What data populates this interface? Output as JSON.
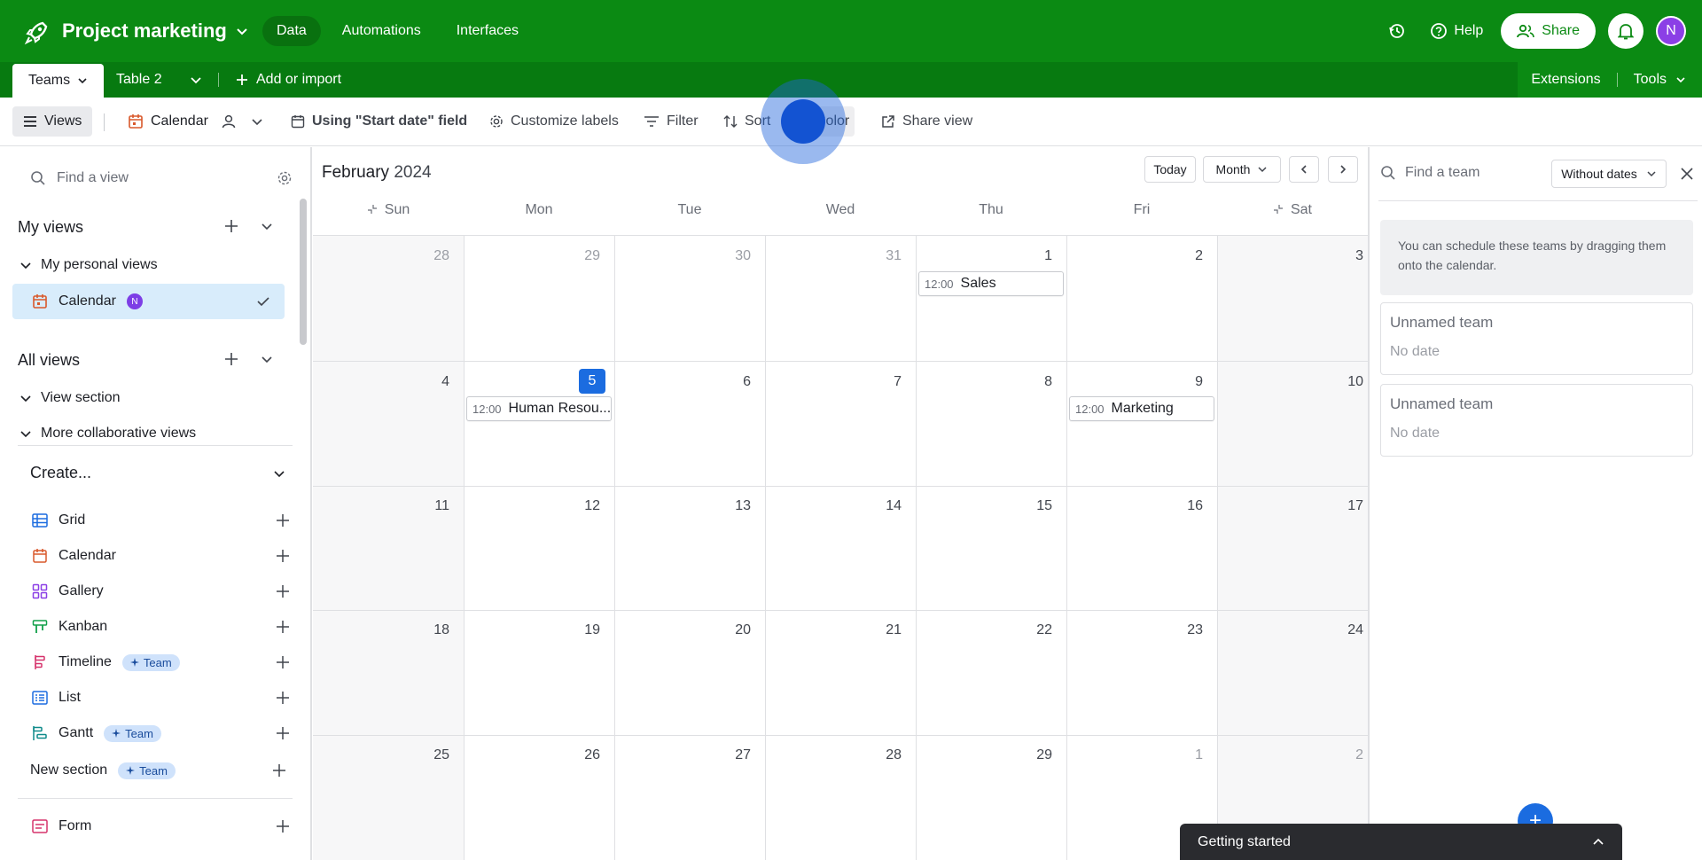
{
  "header": {
    "base_name": "Project marketing",
    "nav": [
      "Data",
      "Automations",
      "Interfaces"
    ],
    "help_label": "Help",
    "share_label": "Share",
    "avatar_initial": "N"
  },
  "tables": {
    "active": "Teams",
    "other": "Table 2",
    "add_label": "Add or import",
    "extensions_label": "Extensions",
    "tools_label": "Tools"
  },
  "viewbar": {
    "views_label": "Views",
    "view_name": "Calendar",
    "date_field": "Using \"Start date\" field",
    "customize": "Customize labels",
    "filter": "Filter",
    "sort": "Sort",
    "color": "Color",
    "share_view": "Share view"
  },
  "sidebar": {
    "find_placeholder": "Find a view",
    "my_views": "My views",
    "my_personal_views": "My personal views",
    "active_view": "Calendar",
    "active_badge": "N",
    "all_views": "All views",
    "view_section": "View section",
    "more_collab": "More collaborative views",
    "create_label": "Create...",
    "create_items": [
      {
        "label": "Grid",
        "icon": "grid-icon"
      },
      {
        "label": "Calendar",
        "icon": "calendar-icon"
      },
      {
        "label": "Gallery",
        "icon": "gallery-icon"
      },
      {
        "label": "Kanban",
        "icon": "kanban-icon"
      },
      {
        "label": "Timeline",
        "icon": "timeline-icon",
        "pill": "Team"
      },
      {
        "label": "List",
        "icon": "list-icon"
      },
      {
        "label": "Gantt",
        "icon": "gantt-icon",
        "pill": "Team"
      },
      {
        "label": "New section",
        "icon": "",
        "pill": "Team"
      },
      {
        "label": "Form",
        "icon": "form-icon"
      }
    ]
  },
  "calendar": {
    "month": "February",
    "year": "2024",
    "today_label": "Today",
    "range_label": "Month",
    "weekdays": [
      "Sun",
      "Mon",
      "Tue",
      "Wed",
      "Thu",
      "Fri",
      "Sat"
    ],
    "weeks": [
      [
        "28",
        "29",
        "30",
        "31",
        "1",
        "2",
        "3"
      ],
      [
        "4",
        "5",
        "6",
        "7",
        "8",
        "9",
        "10"
      ],
      [
        "11",
        "12",
        "13",
        "14",
        "15",
        "16",
        "17"
      ],
      [
        "18",
        "19",
        "20",
        "21",
        "22",
        "23",
        "24"
      ],
      [
        "25",
        "26",
        "27",
        "28",
        "29",
        "1",
        "2"
      ]
    ],
    "today": "5",
    "events": [
      {
        "time": "12:00",
        "title": "Sales"
      },
      {
        "time": "12:00",
        "title": "Human Resou..."
      },
      {
        "time": "12:00",
        "title": "Marketing"
      }
    ]
  },
  "panel": {
    "search_placeholder": "Find a team",
    "filter_label": "Without dates",
    "hint": "You can schedule these teams by dragging them onto the calendar.",
    "cards": [
      {
        "title": "Unnamed team",
        "date": "No date"
      },
      {
        "title": "Unnamed team",
        "date": "No date"
      }
    ]
  },
  "footer": {
    "getting_started": "Getting started"
  },
  "colors": {
    "brand_green": "#0b8a13",
    "accent_blue": "#1b6ce0"
  }
}
